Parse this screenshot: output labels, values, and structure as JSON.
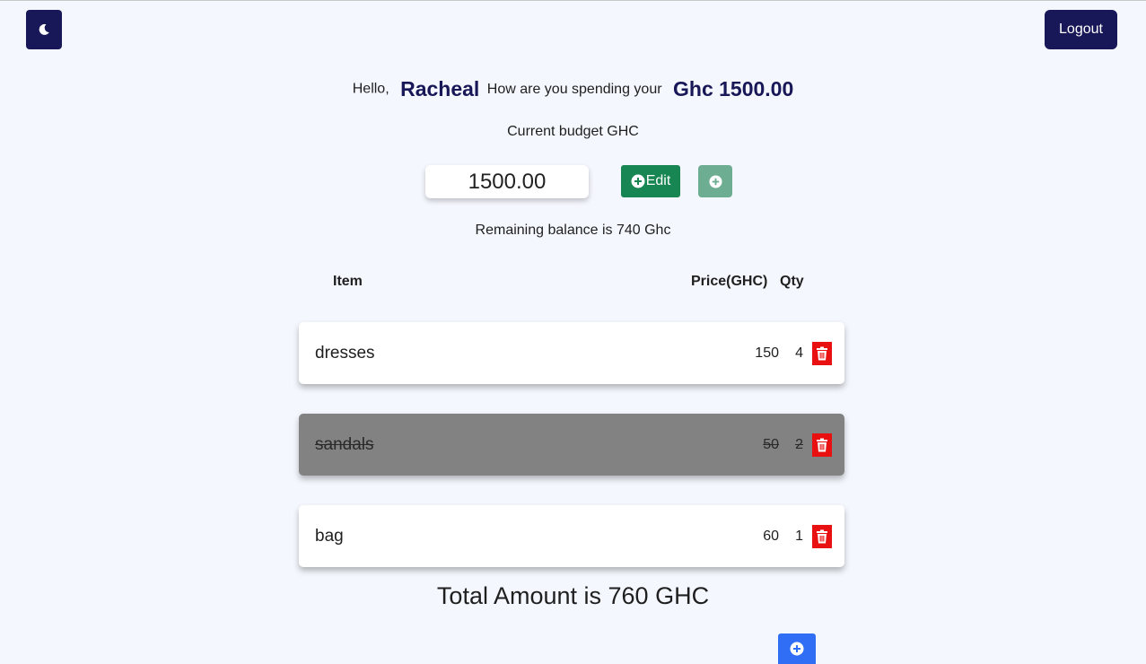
{
  "header": {
    "logout_label": "Logout",
    "theme_icon": "moon-icon"
  },
  "greeting": {
    "hello": "Hello,",
    "name": "Racheal",
    "question": "How are you spending your",
    "amount": "Ghc 1500.00"
  },
  "budget": {
    "label": "Current budget GHC",
    "value": "1500.00",
    "edit_label": "Edit",
    "remaining": "Remaining balance is 740 Ghc"
  },
  "table": {
    "headers": {
      "item": "Item",
      "price": "Price(GHC)",
      "qty": "Qty"
    },
    "rows": [
      {
        "name": "dresses",
        "price": "150",
        "qty": "4",
        "completed": false
      },
      {
        "name": "sandals",
        "price": "50",
        "qty": "2",
        "completed": true
      },
      {
        "name": "bag",
        "price": "60",
        "qty": "1",
        "completed": false
      }
    ]
  },
  "total": "Total Amount is 760 GHC",
  "colors": {
    "navy": "#181757",
    "edit_green": "#188652",
    "add_green": "#6dae92",
    "delete_red": "#e81010",
    "add_blue": "#2f6ef5",
    "completed_row": "#828282"
  }
}
